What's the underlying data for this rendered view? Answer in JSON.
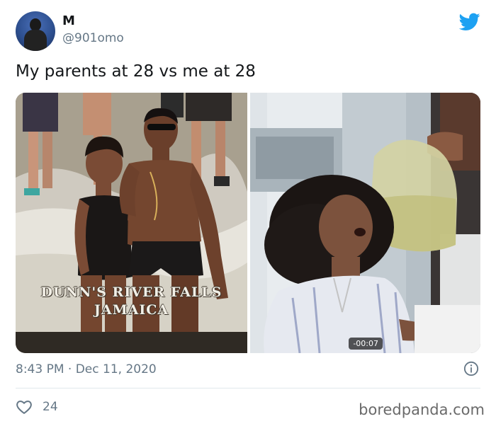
{
  "tweet": {
    "author_name": "M",
    "author_handle": "@901omo",
    "text": "My parents at 28 vs me at 28",
    "timestamp": "8:43 PM · Dec 11, 2020",
    "like_count": "24"
  },
  "media": {
    "left_caption_line1": "DUNN'S RIVER FALLS",
    "left_caption_line2": "JAMAICA",
    "video_duration": "-00:07"
  },
  "watermark": "boredpanda.com",
  "colors": {
    "twitter_blue": "#1da1f2",
    "secondary_text": "#657786",
    "divider": "#e1e8ed"
  },
  "icons": [
    "avatar",
    "twitter-bird-icon",
    "info-icon",
    "heart-icon"
  ]
}
